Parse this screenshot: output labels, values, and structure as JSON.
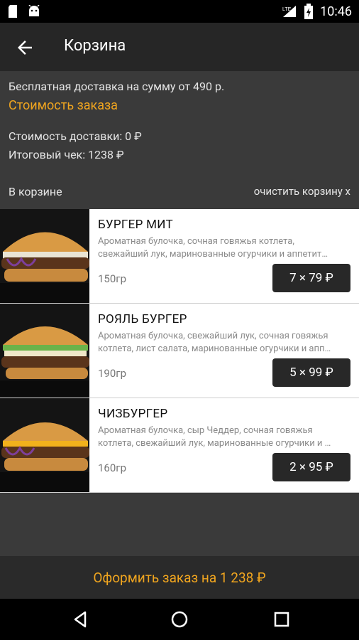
{
  "status": {
    "time": "10:46",
    "network": "LTE"
  },
  "appbar": {
    "title": "Корзина"
  },
  "info": {
    "free_delivery": "Бесплатная доставка на сумму от 490 р.",
    "order_cost_link": "Стоимость заказа",
    "delivery_cost": "Стоимость доставки: 0 ₽",
    "total": "Итоговый чек: 1238 ₽"
  },
  "cart": {
    "heading": "В корзине",
    "clear_label": "очистить корзину x",
    "items": [
      {
        "name": "БУРГЕР МИТ",
        "desc_line1": "Ароматная булочка, сочная говяжья котлета,",
        "desc_line2": "свежайший лук, маринованные огурчики и аппетит…",
        "weight": "150гр",
        "qty_price": "7 × 79 ₽"
      },
      {
        "name": "РОЯЛЬ БУРГЕР",
        "desc_line1": "Ароматная булочка, свежайший лук, сочная говяжья",
        "desc_line2": "котлета, лист салата, маринованные огурчики и апп…",
        "weight": "190гр",
        "qty_price": "5 × 99 ₽"
      },
      {
        "name": "ЧИЗБУРГЕР",
        "desc_line1": "Ароматная булочка, сыр Чеддер, сочная говяжья",
        "desc_line2": "котлета, свежайший лук, маринованные огурчики и …",
        "weight": "160гр",
        "qty_price": "2 × 95 ₽"
      }
    ]
  },
  "checkout": {
    "label": "Оформить заказ на 1 238 ₽"
  },
  "colors": {
    "accent": "#f0a51f",
    "background": "#3a3a3a",
    "appbar": "#262626"
  },
  "icons": {
    "status_left": [
      "sd-card-icon",
      "android-icon"
    ],
    "status_right": [
      "signal-icon",
      "battery-charging-icon"
    ],
    "nav": [
      "back-triangle-icon",
      "home-circle-icon",
      "recents-square-icon"
    ]
  }
}
